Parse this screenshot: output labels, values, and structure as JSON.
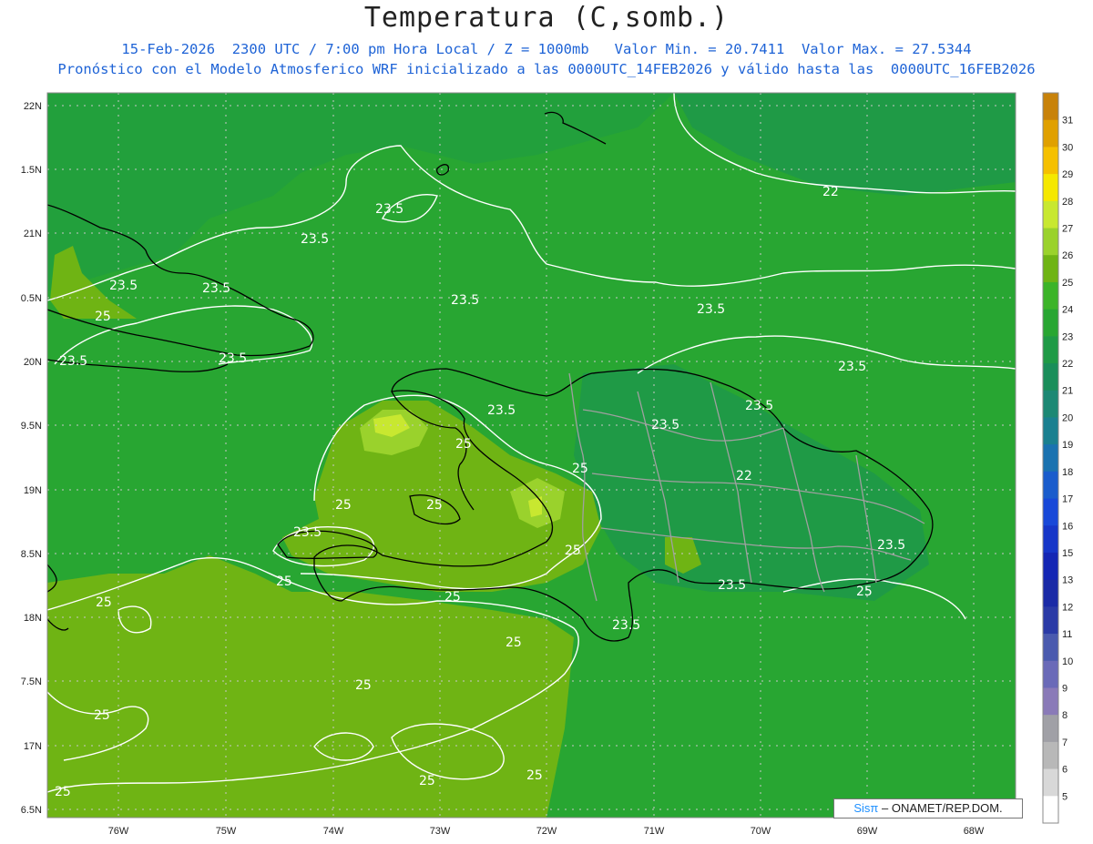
{
  "title": "Temperatura (C,somb.)",
  "subtitle_line1": "15-Feb-2026  2300 UTC / 7:00 pm Hora Local / Z = 1000mb   Valor Min. = 20.7411  Valor Max. = 27.5344",
  "subtitle_line2": "Pronóstico con el Modelo Atmosferico WRF inicializado a las 0000UTC_14FEB2026 y válido hasta las  0000UTC_16FEB2026",
  "lat_ticks": [
    "22N",
    "1.5N",
    "21N",
    "0.5N",
    "20N",
    "9.5N",
    "19N",
    "8.5N",
    "18N",
    "7.5N",
    "17N",
    "6.5N"
  ],
  "lon_ticks": [
    "76W",
    "75W",
    "74W",
    "73W",
    "72W",
    "71W",
    "70W",
    "69W",
    "68W"
  ],
  "contour_labels": [
    {
      "text": "23.5"
    },
    {
      "text": "23.5"
    },
    {
      "text": "22"
    },
    {
      "text": "23.5"
    },
    {
      "text": "23.5"
    },
    {
      "text": "23.5"
    },
    {
      "text": "25"
    },
    {
      "text": "23.5"
    },
    {
      "text": "23.5"
    },
    {
      "text": "23.5"
    },
    {
      "text": "23.5"
    },
    {
      "text": "23.5"
    },
    {
      "text": "23.5"
    },
    {
      "text": "25"
    },
    {
      "text": "25"
    },
    {
      "text": "22"
    },
    {
      "text": "25"
    },
    {
      "text": "25"
    },
    {
      "text": "23.5"
    },
    {
      "text": "25"
    },
    {
      "text": "25"
    },
    {
      "text": "25"
    },
    {
      "text": "23.5"
    },
    {
      "text": "23.5"
    },
    {
      "text": "23.5"
    },
    {
      "text": "25"
    },
    {
      "text": "25"
    },
    {
      "text": "25"
    },
    {
      "text": "23.5"
    },
    {
      "text": "25"
    },
    {
      "text": "25"
    },
    {
      "text": "25"
    },
    {
      "text": "25"
    },
    {
      "text": "25"
    }
  ],
  "colorbar": {
    "labels": [
      "31",
      "30",
      "29",
      "28",
      "27",
      "26",
      "25",
      "24",
      "23",
      "22",
      "21",
      "20",
      "19",
      "18",
      "17",
      "16",
      "15",
      "13",
      "12",
      "11",
      "10",
      "9",
      "8",
      "7",
      "6",
      "5"
    ],
    "colors": [
      "#c8820a",
      "#e0a000",
      "#f5c000",
      "#f5e800",
      "#c8e830",
      "#9ad22c",
      "#6fb414",
      "#3cb428",
      "#28a632",
      "#1f9a46",
      "#1a8e5a",
      "#1c8874",
      "#1a8090",
      "#1a72b0",
      "#1a5ccc",
      "#1848d8",
      "#1636c8",
      "#1426b4",
      "#1a2aa6",
      "#2a3aa6",
      "#4a5aae",
      "#6a6ab8",
      "#8a7ab8",
      "#a0a0a6",
      "#b8b8b8",
      "#d8d8d8",
      "#ffffff"
    ]
  },
  "credit": {
    "brand": "Sisπ",
    "rest": "– ONAMET/REP.DOM."
  },
  "colors": {
    "field_base": "#28a632",
    "field_dark": "#1f9a46",
    "field_warm": "#6fb414",
    "field_hot": "#9ad22c",
    "field_hottest": "#c8e830",
    "contour": "#ffffff",
    "coast": "#000000",
    "border": "#a0a0a0",
    "grid": "#c0c0c0"
  }
}
